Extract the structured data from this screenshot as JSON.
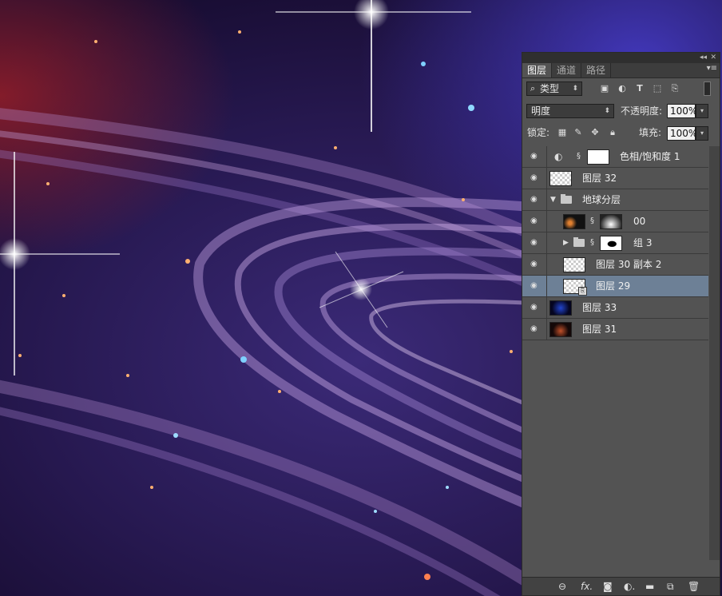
{
  "panel": {
    "collapse_icon": "double-chevron-icon",
    "close_icon": "close-icon",
    "tabs": [
      {
        "label": "图层",
        "active": true
      },
      {
        "label": "通道",
        "active": false
      },
      {
        "label": "路径",
        "active": false
      }
    ],
    "filter": {
      "kind_label": "类型",
      "icons": [
        "pixel-filter-icon",
        "adjustment-filter-icon",
        "type-filter-icon",
        "shape-filter-icon",
        "smart-object-filter-icon"
      ]
    },
    "blend_mode": "明度",
    "opacity_label": "不透明度:",
    "opacity_value": "100%",
    "lock_label": "锁定:",
    "fill_label": "填充:",
    "fill_value": "100%",
    "layers": [
      {
        "name": "色相/饱和度 1",
        "type": "adjustment"
      },
      {
        "name": "图层 32",
        "type": "layer"
      },
      {
        "name": "地球分层",
        "type": "group",
        "expanded": true
      },
      {
        "name": "00",
        "type": "layer-with-mask"
      },
      {
        "name": "组 3",
        "type": "group",
        "expanded": false
      },
      {
        "name": "图层 30 副本 2",
        "type": "layer"
      },
      {
        "name": "图层 29",
        "type": "smart-object",
        "selected": true
      },
      {
        "name": "图层 33",
        "type": "layer"
      },
      {
        "name": "图层 31",
        "type": "layer"
      }
    ],
    "bottom_icons": [
      "link-layers-icon",
      "fx-icon",
      "add-mask-icon",
      "new-adjustment-icon",
      "new-group-icon",
      "new-layer-icon",
      "delete-layer-icon"
    ]
  },
  "colors": {
    "panel_bg": "#535353",
    "selected_row": "#6d8096"
  }
}
